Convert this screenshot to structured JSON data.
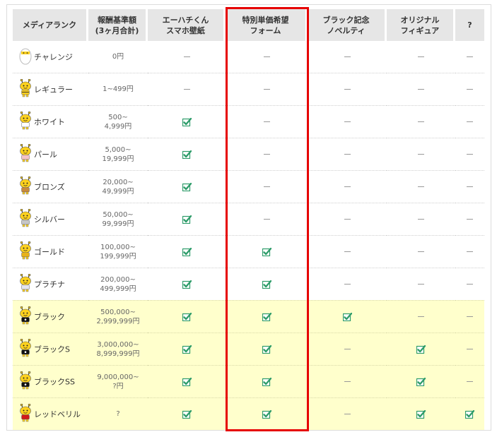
{
  "headers": [
    "メディアランク",
    "報酬基準額\n(3ヶ月合計)",
    "エーハチくん\nスマホ壁紙",
    "特別単価希望\nフォーム",
    "ブラック記念\nノベルティ",
    "オリジナル\nフィギュア",
    "?"
  ],
  "rows": [
    {
      "rank": "チャレンジ",
      "fee": "0円",
      "wallpaper": false,
      "form": false,
      "novelty": false,
      "figure": false,
      "q": false,
      "shirt": "egg",
      "highlight": false
    },
    {
      "rank": "レギュラー",
      "fee": "1~499円",
      "wallpaper": false,
      "form": false,
      "novelty": false,
      "figure": false,
      "q": false,
      "shirt": "none",
      "highlight": false
    },
    {
      "rank": "ホワイト",
      "fee": "500~\n4,999円",
      "wallpaper": true,
      "form": false,
      "novelty": false,
      "figure": false,
      "q": false,
      "shirt": "white",
      "highlight": false
    },
    {
      "rank": "パール",
      "fee": "5,000~\n19,999円",
      "wallpaper": true,
      "form": false,
      "novelty": false,
      "figure": false,
      "q": false,
      "shirt": "pearl",
      "highlight": false
    },
    {
      "rank": "ブロンズ",
      "fee": "20,000~\n49,999円",
      "wallpaper": true,
      "form": false,
      "novelty": false,
      "figure": false,
      "q": false,
      "shirt": "bronze",
      "highlight": false
    },
    {
      "rank": "シルバー",
      "fee": "50,000~\n99,999円",
      "wallpaper": true,
      "form": false,
      "novelty": false,
      "figure": false,
      "q": false,
      "shirt": "silver",
      "highlight": false
    },
    {
      "rank": "ゴールド",
      "fee": "100,000~\n199,999円",
      "wallpaper": true,
      "form": true,
      "novelty": false,
      "figure": false,
      "q": false,
      "shirt": "gold",
      "highlight": false
    },
    {
      "rank": "プラチナ",
      "fee": "200,000~\n499,999円",
      "wallpaper": true,
      "form": true,
      "novelty": false,
      "figure": false,
      "q": false,
      "shirt": "platinum",
      "highlight": false
    },
    {
      "rank": "ブラック",
      "fee": "500,000~\n2,999,999円",
      "wallpaper": true,
      "form": true,
      "novelty": true,
      "figure": false,
      "q": false,
      "shirt": "black",
      "highlight": true
    },
    {
      "rank": "ブラックS",
      "fee": "3,000,000~\n8,999,999円",
      "wallpaper": true,
      "form": true,
      "novelty": false,
      "figure": true,
      "q": false,
      "shirt": "black",
      "highlight": true
    },
    {
      "rank": "ブラックSS",
      "fee": "9,000,000~\n?円",
      "wallpaper": true,
      "form": true,
      "novelty": false,
      "figure": true,
      "q": false,
      "shirt": "black",
      "highlight": true
    },
    {
      "rank": "レッドベリル",
      "fee": "?",
      "wallpaper": true,
      "form": true,
      "novelty": false,
      "figure": true,
      "q": true,
      "shirt": "red",
      "highlight": true
    }
  ],
  "colors": {
    "header_bg": "#e6e6e6",
    "highlight_rows_bg": "#ffffcc",
    "check_green": "#2e9c6a",
    "annotation_red": "#e60000",
    "bee_yellow": "#ffd21e"
  },
  "icons": {
    "check": "checkbox-check-icon",
    "none": "dash-icon",
    "mascot": "bee-mascot-icon"
  }
}
